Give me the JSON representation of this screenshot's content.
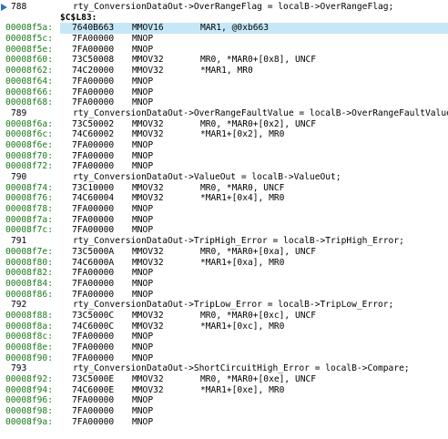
{
  "rows": [
    {
      "type": "src",
      "line": "788",
      "text": "rty_ConversionDataOut->OverRangeFlag = localB->OverRangeFlag;",
      "arrow": true
    },
    {
      "type": "label",
      "text": "$C$L83:"
    },
    {
      "type": "asm",
      "addr": "00008f5a:",
      "op": "7640B663",
      "mn": "MMOV16",
      "args": "MAR1, @0xb663",
      "current": true
    },
    {
      "type": "asm",
      "addr": "00008f5c:",
      "op": "7FA00000",
      "mn": "MNOP",
      "args": ""
    },
    {
      "type": "asm",
      "addr": "00008f5e:",
      "op": "7FA00000",
      "mn": "MNOP",
      "args": ""
    },
    {
      "type": "asm",
      "addr": "00008f60:",
      "op": "73C50008",
      "mn": "MMOV32",
      "args": "MR0, *MAR0+[0x8], UNCF"
    },
    {
      "type": "asm",
      "addr": "00008f62:",
      "op": "74C20000",
      "mn": "MMOV32",
      "args": "*MAR1, MR0"
    },
    {
      "type": "asm",
      "addr": "00008f64:",
      "op": "7FA00000",
      "mn": "MNOP",
      "args": ""
    },
    {
      "type": "asm",
      "addr": "00008f66:",
      "op": "7FA00000",
      "mn": "MNOP",
      "args": ""
    },
    {
      "type": "asm",
      "addr": "00008f68:",
      "op": "7FA00000",
      "mn": "MNOP",
      "args": ""
    },
    {
      "type": "src",
      "line": "789",
      "text": "rty_ConversionDataOut->OverRangeFaultValue = localB->OverRangeFaultValue;"
    },
    {
      "type": "asm",
      "addr": "00008f6a:",
      "op": "73C50002",
      "mn": "MMOV32",
      "args": "MR0, *MAR0+[0x2], UNCF"
    },
    {
      "type": "asm",
      "addr": "00008f6c:",
      "op": "74C60002",
      "mn": "MMOV32",
      "args": "*MAR1+[0x2], MR0"
    },
    {
      "type": "asm",
      "addr": "00008f6e:",
      "op": "7FA00000",
      "mn": "MNOP",
      "args": ""
    },
    {
      "type": "asm",
      "addr": "00008f70:",
      "op": "7FA00000",
      "mn": "MNOP",
      "args": ""
    },
    {
      "type": "asm",
      "addr": "00008f72:",
      "op": "7FA00000",
      "mn": "MNOP",
      "args": ""
    },
    {
      "type": "src",
      "line": "790",
      "text": "rty_ConversionDataOut->ValueOut = localB->ValueOut;"
    },
    {
      "type": "asm",
      "addr": "00008f74:",
      "op": "73C10000",
      "mn": "MMOV32",
      "args": "MR0, *MAR0, UNCF"
    },
    {
      "type": "asm",
      "addr": "00008f76:",
      "op": "74C60004",
      "mn": "MMOV32",
      "args": "*MAR1+[0x4], MR0"
    },
    {
      "type": "asm",
      "addr": "00008f78:",
      "op": "7FA00000",
      "mn": "MNOP",
      "args": ""
    },
    {
      "type": "asm",
      "addr": "00008f7a:",
      "op": "7FA00000",
      "mn": "MNOP",
      "args": ""
    },
    {
      "type": "asm",
      "addr": "00008f7c:",
      "op": "7FA00000",
      "mn": "MNOP",
      "args": ""
    },
    {
      "type": "src",
      "line": "791",
      "text": "rty_ConversionDataOut->TripHigh_Error = localB->TripHigh_Error;"
    },
    {
      "type": "asm",
      "addr": "00008f7e:",
      "op": "73C5000A",
      "mn": "MMOV32",
      "args": "MR0, *MAR0+[0xa], UNCF"
    },
    {
      "type": "asm",
      "addr": "00008f80:",
      "op": "74C6000A",
      "mn": "MMOV32",
      "args": "*MAR1+[0xa], MR0"
    },
    {
      "type": "asm",
      "addr": "00008f82:",
      "op": "7FA00000",
      "mn": "MNOP",
      "args": ""
    },
    {
      "type": "asm",
      "addr": "00008f84:",
      "op": "7FA00000",
      "mn": "MNOP",
      "args": ""
    },
    {
      "type": "asm",
      "addr": "00008f86:",
      "op": "7FA00000",
      "mn": "MNOP",
      "args": ""
    },
    {
      "type": "src",
      "line": "792",
      "text": "rty_ConversionDataOut->TripLow_Error = localB->TripLow_Error;"
    },
    {
      "type": "asm",
      "addr": "00008f88:",
      "op": "73C5000C",
      "mn": "MMOV32",
      "args": "MR0, *MAR0+[0xc], UNCF"
    },
    {
      "type": "asm",
      "addr": "00008f8a:",
      "op": "74C6000C",
      "mn": "MMOV32",
      "args": "*MAR1+[0xc], MR0"
    },
    {
      "type": "asm",
      "addr": "00008f8c:",
      "op": "7FA00000",
      "mn": "MNOP",
      "args": ""
    },
    {
      "type": "asm",
      "addr": "00008f8e:",
      "op": "7FA00000",
      "mn": "MNOP",
      "args": ""
    },
    {
      "type": "asm",
      "addr": "00008f90:",
      "op": "7FA00000",
      "mn": "MNOP",
      "args": ""
    },
    {
      "type": "src",
      "line": "793",
      "text": "rty_ConversionDataOut->ShortCircuitHigh_Error = localB->Compare;"
    },
    {
      "type": "asm",
      "addr": "00008f92:",
      "op": "73C5000E",
      "mn": "MMOV32",
      "args": "MR0, *MAR0+[0xe], UNCF"
    },
    {
      "type": "asm",
      "addr": "00008f94:",
      "op": "74C6000E",
      "mn": "MMOV32",
      "args": "*MAR1+[0xe], MR0"
    },
    {
      "type": "asm",
      "addr": "00008f96:",
      "op": "7FA00000",
      "mn": "MNOP",
      "args": ""
    },
    {
      "type": "asm",
      "addr": "00008f98:",
      "op": "7FA00000",
      "mn": "MNOP",
      "args": ""
    },
    {
      "type": "asm",
      "addr": "00008f9a:",
      "op": "7FA00000",
      "mn": "MNOP",
      "args": ""
    }
  ],
  "colors": {
    "address": "#1a7a1a",
    "highlight": "#c6e7f8",
    "arrow": "#2f6fc0"
  },
  "icons": {
    "current_line": "program-counter-arrow-icon"
  }
}
